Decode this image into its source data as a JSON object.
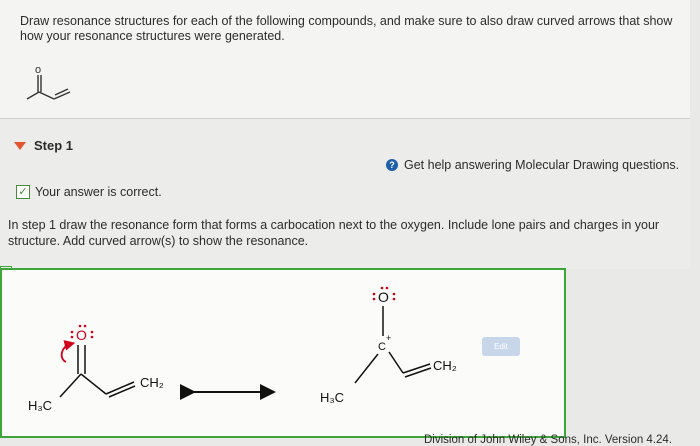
{
  "question": {
    "text": "Draw resonance structures for each of the following compounds, and make sure to also draw curved arrows that show how your resonance structures were generated.",
    "atom_o": "o"
  },
  "step": {
    "label": "Step 1",
    "help_text": "Get help answering Molecular Drawing questions.",
    "help_icon_glyph": "?",
    "status": "Your answer is correct.",
    "instructions": "In step 1 draw the resonance form that forms a carbocation next to the oxygen. Include lone pairs and charges in your structure. Add curved arrow(s) to show the resonance."
  },
  "drawing": {
    "left_structure": {
      "oxygen": "O",
      "methyl_label": "H₃C",
      "methylene_label": "CH₂"
    },
    "right_structure": {
      "oxygen": "O",
      "carbon": "C",
      "charge": "+",
      "methyl_label": "H₃C",
      "methylene_label": "CH₂"
    },
    "edit_button": "Edit"
  },
  "footer": {
    "text": "Division of John Wiley & Sons, Inc. Version 4.24."
  },
  "colors": {
    "accent_orange": "#e4572e",
    "success_green": "#3ea53a",
    "arrow_red": "#d0021b",
    "help_blue": "#1e5fa8"
  }
}
